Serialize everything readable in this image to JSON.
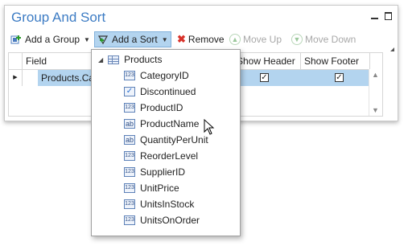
{
  "panel": {
    "title": "Group And Sort"
  },
  "toolbar": {
    "add_group": "Add a Group",
    "add_sort": "Add a Sort",
    "remove": "Remove",
    "move_up": "Move Up",
    "move_down": "Move Down"
  },
  "grid": {
    "columns": [
      "Field",
      "Show Header",
      "Show Footer"
    ],
    "rows": [
      {
        "field": "Products.Cat",
        "show_header": true,
        "show_footer": true
      }
    ]
  },
  "dropdown": {
    "root": "Products",
    "fields": [
      {
        "name": "CategoryID",
        "type": "number"
      },
      {
        "name": "Discontinued",
        "type": "boolean"
      },
      {
        "name": "ProductID",
        "type": "number"
      },
      {
        "name": "ProductName",
        "type": "text"
      },
      {
        "name": "QuantityPerUnit",
        "type": "text"
      },
      {
        "name": "ReorderLevel",
        "type": "number"
      },
      {
        "name": "SupplierID",
        "type": "number"
      },
      {
        "name": "UnitPrice",
        "type": "number"
      },
      {
        "name": "UnitsInStock",
        "type": "number"
      },
      {
        "name": "UnitsOnOrder",
        "type": "number"
      }
    ]
  },
  "icons": {
    "number": "123",
    "text": "ab",
    "boolean": "✓"
  },
  "colors": {
    "title": "#3d7cc4",
    "selection": "#b3d4ef"
  }
}
